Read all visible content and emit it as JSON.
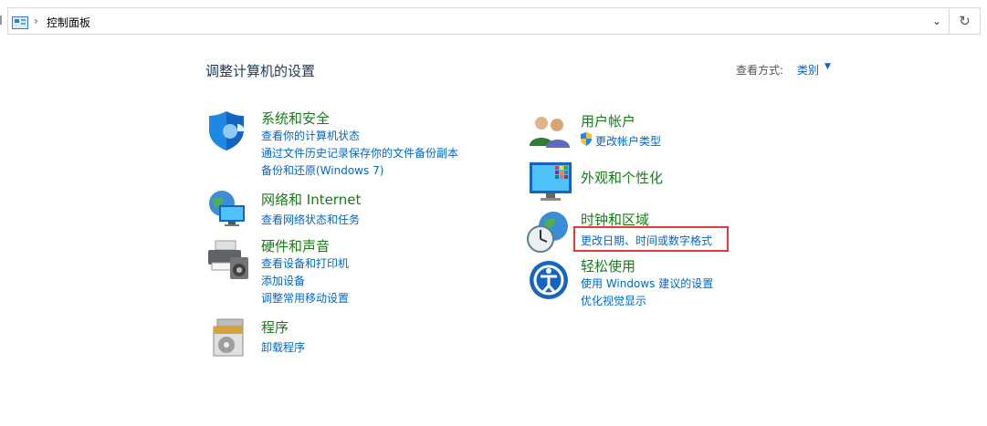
{
  "address_bar": {
    "crumb": "控制面板",
    "separator": "›",
    "dropdown_glyph": "⌄",
    "refresh_glyph": "↻"
  },
  "page_title": "调整计算机的设置",
  "view": {
    "label": "查看方式:",
    "value": "类别",
    "arrow": "▼"
  },
  "categories": [
    {
      "title": "系统和安全",
      "links": [
        "查看你的计算机状态",
        "通过文件历史记录保存你的文件备份副本",
        "备份和还原(Windows 7)"
      ]
    },
    {
      "title": "网络和 Internet",
      "links": [
        "查看网络状态和任务"
      ]
    },
    {
      "title": "硬件和声音",
      "links": [
        "查看设备和打印机",
        "添加设备",
        "调整常用移动设置"
      ]
    },
    {
      "title": "程序",
      "links": [
        "卸载程序"
      ]
    },
    {
      "title": "用户帐户",
      "links": [
        "更改帐户类型"
      ]
    },
    {
      "title": "外观和个性化",
      "links": []
    },
    {
      "title": "时钟和区域",
      "links": [
        "更改日期、时间或数字格式"
      ]
    },
    {
      "title": "轻松使用",
      "links": [
        "使用 Windows 建议的设置",
        "优化视觉显示"
      ]
    }
  ],
  "colors": {
    "heading": "#1a7a1a",
    "link": "#0066cc",
    "highlight_box": "#e53935"
  }
}
